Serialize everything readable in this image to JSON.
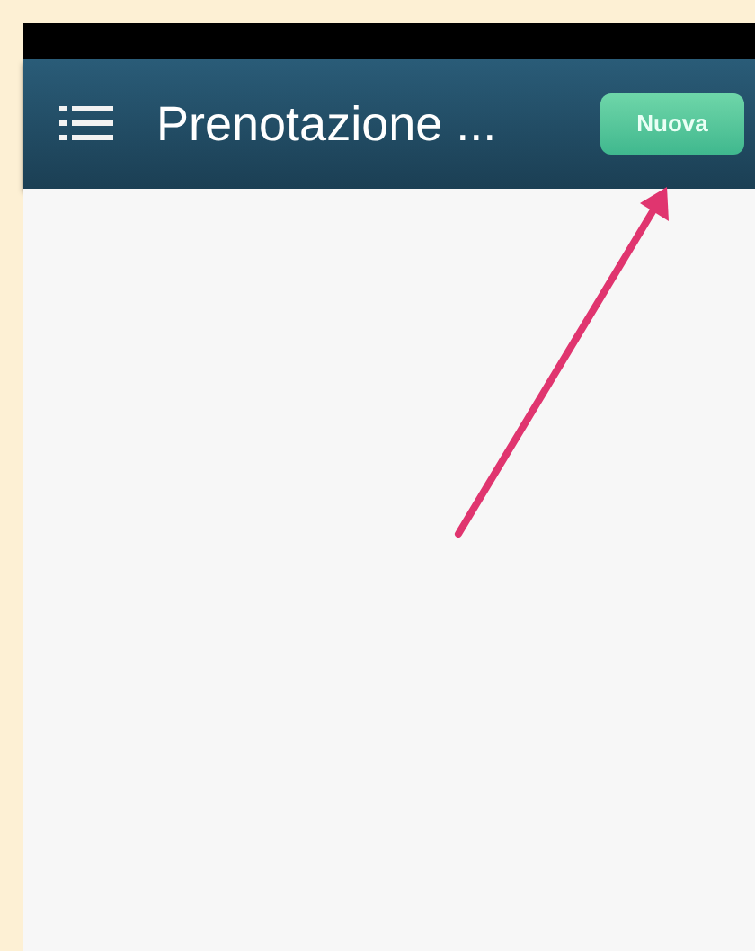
{
  "header": {
    "title": "Prenotazione ...",
    "button": "Nuova"
  }
}
